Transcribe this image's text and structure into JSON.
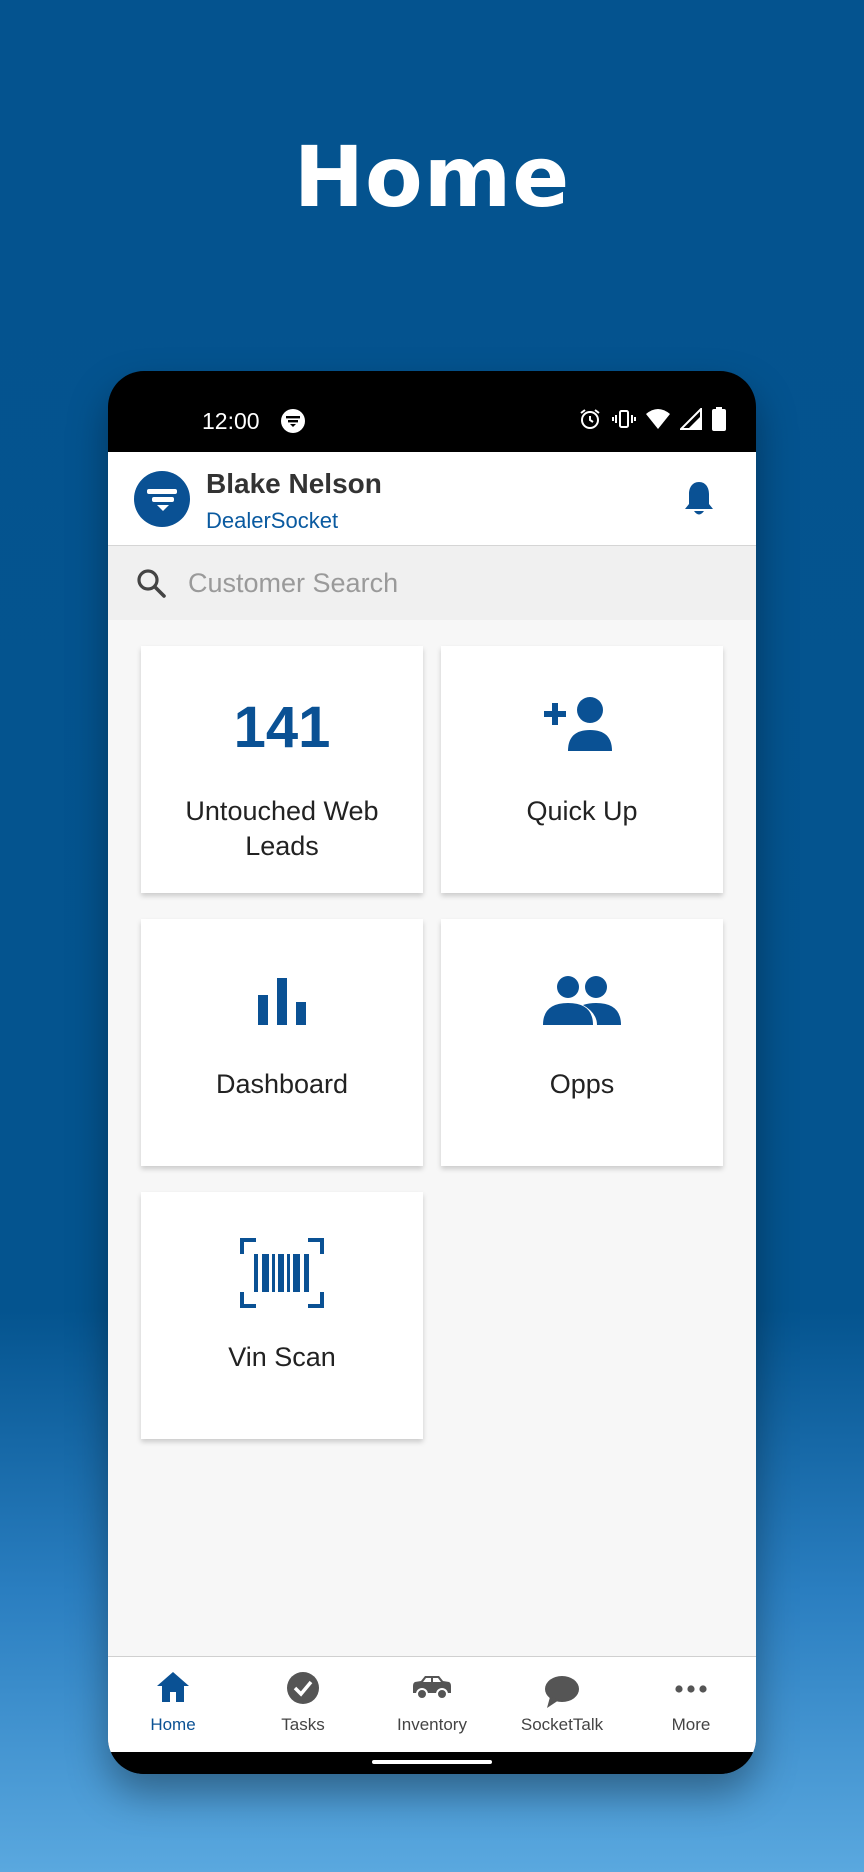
{
  "page": {
    "title": "Home"
  },
  "statusbar": {
    "time": "12:00"
  },
  "header": {
    "user_name": "Blake Nelson",
    "company": "DealerSocket"
  },
  "search": {
    "placeholder": "Customer Search"
  },
  "tiles": [
    {
      "count": "141",
      "label": "Untouched Web Leads",
      "label_line1": "Untouched Web",
      "label_line2": "Leads"
    },
    {
      "label": "Quick Up",
      "icon": "add-person-icon"
    },
    {
      "label": "Dashboard",
      "icon": "bar-chart-icon"
    },
    {
      "label": "Opps",
      "icon": "people-icon"
    },
    {
      "label": "Vin Scan",
      "icon": "barcode-scan-icon"
    }
  ],
  "bottom_nav": [
    {
      "label": "Home",
      "icon": "home-icon",
      "active": true
    },
    {
      "label": "Tasks",
      "icon": "check-circle-icon"
    },
    {
      "label": "Inventory",
      "icon": "car-icon"
    },
    {
      "label": "SocketTalk",
      "icon": "chat-bubble-icon"
    },
    {
      "label": "More",
      "icon": "more-dots-icon"
    }
  ],
  "colors": {
    "brand_blue": "#0a5194",
    "background_blue": "#04538f",
    "active_nav": "#0a5194"
  }
}
